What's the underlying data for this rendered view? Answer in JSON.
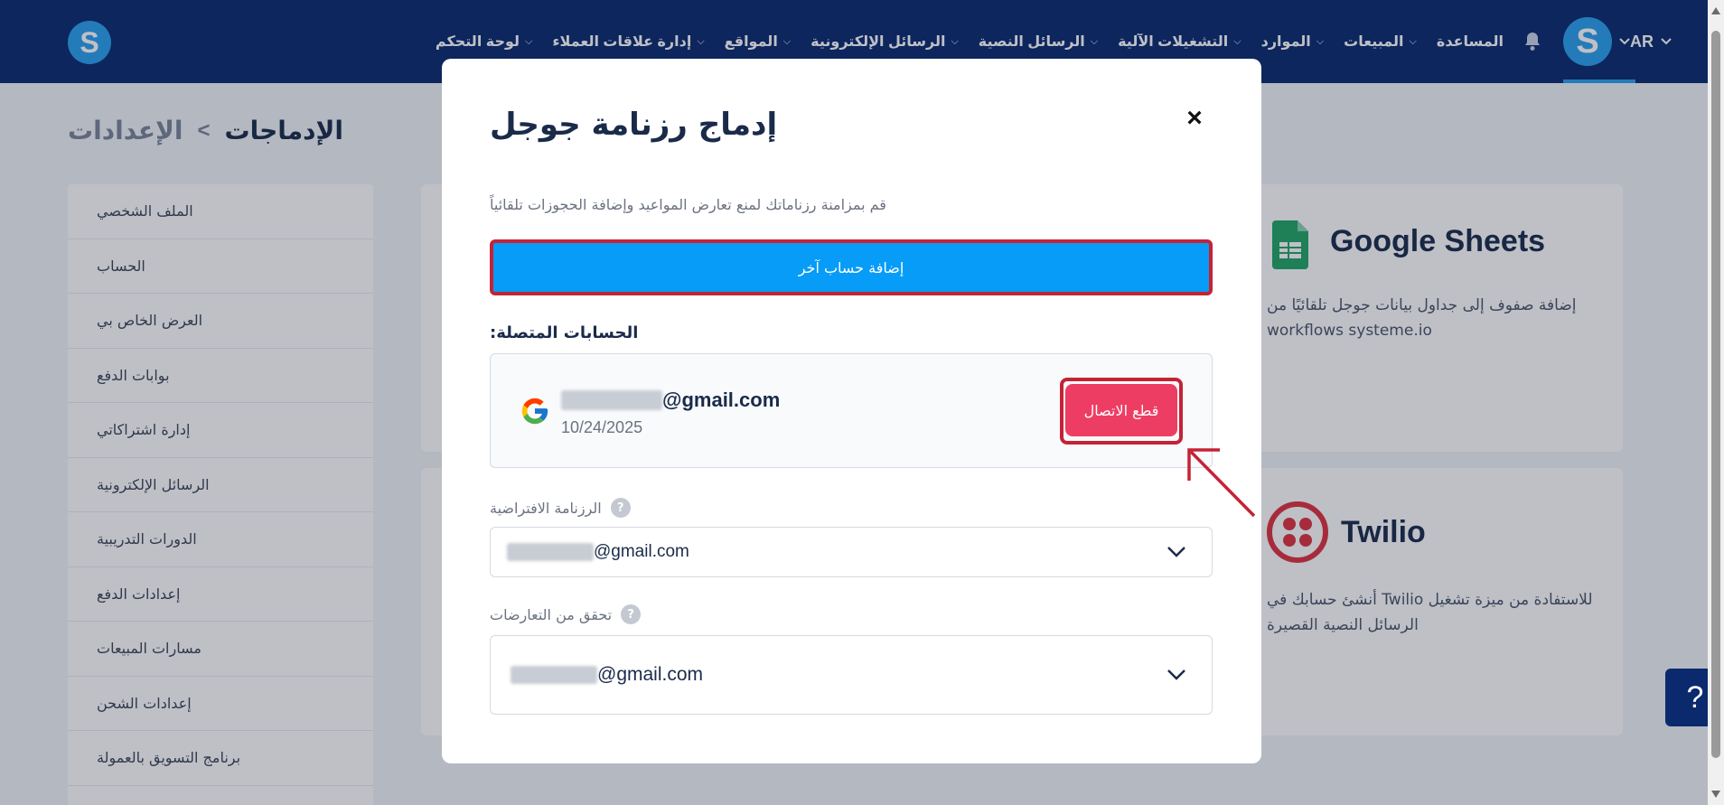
{
  "topbar": {
    "logo_letter": "S",
    "avatar_letter": "S",
    "lang": "AR",
    "nav_items": [
      "لوحة التحكم",
      "إدارة علاقات العملاء",
      "المواقع",
      "الرسائل الإلكترونية",
      "الرسائل النصية",
      "التشغيلات الآلية",
      "الموارد",
      "المبيعات",
      "المساعدة"
    ]
  },
  "breadcrumb": {
    "parent": "الإعدادات",
    "separator": "<",
    "current": "الإدماجات"
  },
  "sidebar": {
    "items": [
      "الملف الشخصي",
      "الحساب",
      "العرض الخاص بي",
      "بوابات الدفع",
      "إدارة اشتراكاتي",
      "الرسائل الإلكترونية",
      "الدورات التدريبية",
      "إعدادات الدفع",
      "مسارات المبيعات",
      "إعدادات الشحن",
      "برنامج التسويق بالعمولة"
    ]
  },
  "cards": {
    "sheets": {
      "title": "Google Sheets",
      "desc_line1": "إضافة صفوف إلى جداول بيانات جوجل تلقائيًا من",
      "desc_line2": "workflows systeme.io"
    },
    "twilio": {
      "title": "Twilio",
      "desc_line1": "للاستفادة من ميزة تشغيل Twilio أنشئ حسابك في",
      "desc_line2": "الرسائل النصية القصيرة"
    }
  },
  "modal": {
    "title": "إدماج رزنامة جوجل",
    "close": "×",
    "subtitle": "قم بمزامنة رزناماتك لمنع تعارض المواعيد وإضافة الحجوزات تلقائياً",
    "add_button": "إضافة حساب آخر",
    "accounts_label": "الحسابات المتصلة:",
    "account": {
      "email_suffix": "@gmail.com",
      "date": "10/24/2025",
      "disconnect": "قطع الاتصال"
    },
    "default_calendar": {
      "label": "الرزنامة الافتراضية",
      "value_suffix": "@gmail.com"
    },
    "conflicts": {
      "label": "تحقق من التعارضات",
      "value_suffix": "@gmail.com"
    }
  },
  "help_button": "?",
  "colors": {
    "nav_bg": "#0b2a6e",
    "primary": "#069cf7",
    "danger": "#ee3d63",
    "annotation": "#c52236"
  }
}
